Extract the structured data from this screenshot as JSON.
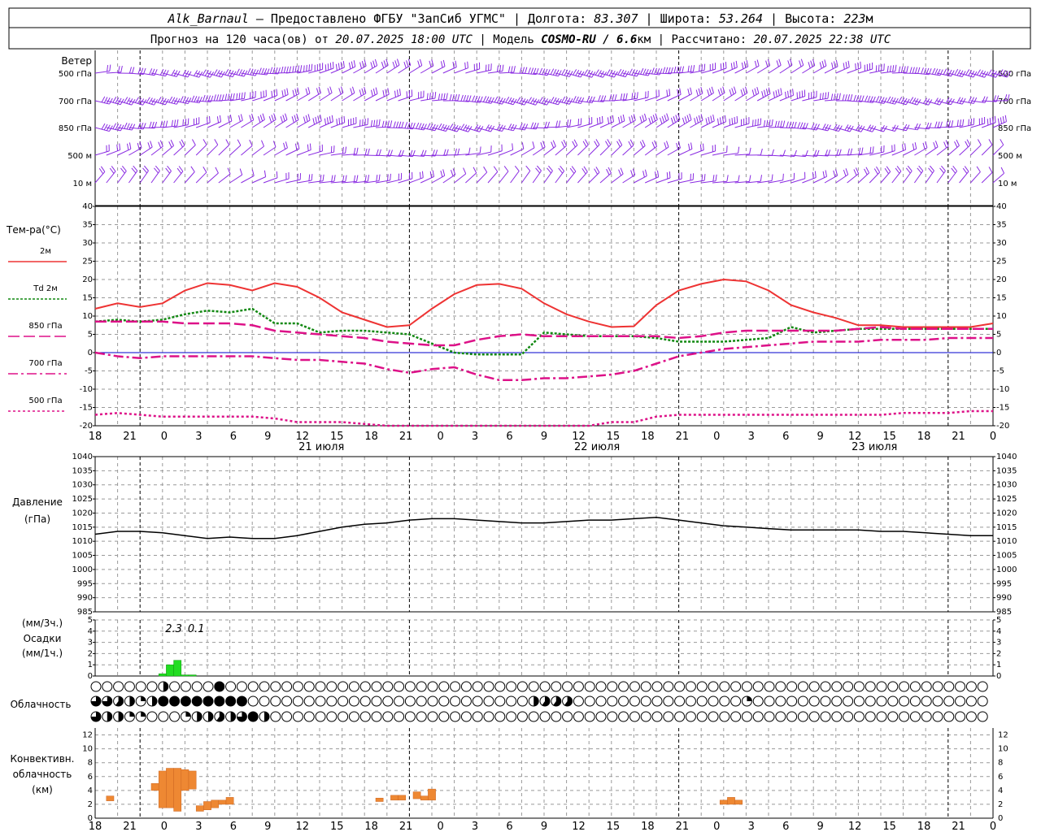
{
  "header": {
    "line1": {
      "station": "Alk_Barnaul",
      "provider": " – Предоставлено ФГБУ \"ЗапСиб УГМС\" | Долгота: ",
      "lon": "83.307",
      "lat_label": " | Широта: ",
      "lat": "53.264",
      "alt_label": " | Высота: ",
      "alt": "223",
      "alt_unit": "м"
    },
    "line2": {
      "prefix": "Прогноз на 120 часа(ов) от ",
      "init": "20.07.2025 18:00 UTC",
      "model_label": "  | Модель ",
      "model": "COSMO-RU / 6.6",
      "model_unit": "км",
      "calc_label": " | Рассчитано: ",
      "calc": "20.07.2025 22:38 UTC"
    }
  },
  "wind_panel": {
    "title": "Ветер",
    "levels": [
      "500 гПа",
      "700 гПа",
      "850 гПа",
      "500 м",
      "10  м"
    ],
    "colors": {
      "barb": "#8a2be2"
    }
  },
  "temp_panel": {
    "title": "Тем-ра(°C)",
    "legend": [
      {
        "label": "2м",
        "color": "#ee3333",
        "dash": ""
      },
      {
        "label": "Td  2м",
        "color": "#118811",
        "dash": "3,2"
      },
      {
        "label": "850 гПа",
        "color": "#dd1188",
        "dash": "14,5"
      },
      {
        "label": "700 гПа",
        "color": "#dd1188",
        "dash": "12,4,3,4"
      },
      {
        "label": "500 гПа",
        "color": "#dd1188",
        "dash": "3,3"
      }
    ],
    "ylim": [
      -20,
      40
    ],
    "yticks": [
      "40",
      "35",
      "30",
      "25",
      "20",
      "15",
      "10",
      "5",
      "0",
      "-5",
      "-10",
      "-15",
      "-20"
    ]
  },
  "x_axis": {
    "hour_labels": [
      "18",
      "21",
      "0",
      "3",
      "6",
      "9",
      "12",
      "15",
      "18",
      "21",
      "0",
      "3",
      "6",
      "9",
      "12",
      "15",
      "18",
      "21",
      "0",
      "3",
      "6",
      "9",
      "12",
      "15",
      "18",
      "21",
      "0"
    ],
    "day_labels": [
      "21 июля",
      "22 июля",
      "23 июля"
    ]
  },
  "pressure_panel": {
    "title": "Давление",
    "unit": "(гПа)",
    "ylim": [
      985,
      1040
    ],
    "yticks": [
      "1040",
      "1035",
      "1030",
      "1025",
      "1020",
      "1015",
      "1010",
      "1005",
      "1000",
      "995",
      "990",
      "985"
    ]
  },
  "precip_panel": {
    "unit3": "(мм/3ч.)",
    "title": "Осадки",
    "unit1": "(мм/1ч.)",
    "yticks": [
      "5",
      "4",
      "3",
      "2",
      "1",
      "0"
    ],
    "totals": [
      {
        "text": "2.3",
        "hour": 10.5
      },
      {
        "text": "0.1",
        "hour": 13.5
      }
    ]
  },
  "cloud_panel": {
    "title": "Облачность"
  },
  "conv_panel": {
    "title_lines": [
      "Конвективн.",
      "облачность",
      "(км)"
    ],
    "yticks": [
      "12",
      "10",
      "8",
      "6",
      "4",
      "2",
      "0"
    ]
  },
  "chart_data": [
    {
      "type": "line",
      "name": "temperature",
      "x_hours_from_start": [
        0,
        3,
        6,
        9,
        12,
        15,
        18,
        21,
        24,
        27,
        30,
        33,
        36,
        39,
        42,
        45,
        48,
        51,
        54,
        57,
        60,
        63,
        66,
        69,
        72,
        75,
        78,
        81,
        84,
        87,
        90,
        93,
        96,
        99,
        102,
        105,
        108,
        111,
        114,
        117,
        120
      ],
      "series": [
        {
          "name": "2м",
          "values": [
            12,
            13.5,
            12.5,
            13.5,
            17,
            19,
            18.5,
            17,
            19,
            18,
            15,
            11,
            9,
            7,
            7.5,
            12,
            16,
            18.5,
            18.8,
            17.5,
            13.5,
            10.5,
            8.5,
            7,
            7.2,
            13,
            17,
            18.8,
            20,
            19.5,
            17,
            13,
            11,
            9.5,
            7.5,
            7.5,
            7,
            7,
            7,
            7,
            8
          ]
        },
        {
          "name": "Td  2м",
          "values": [
            8.5,
            9,
            8.5,
            9,
            10.5,
            11.5,
            11,
            12,
            8,
            8,
            5.5,
            6,
            6,
            5.5,
            5,
            2.5,
            0,
            -0.5,
            -0.5,
            -0.5,
            5.5,
            5,
            4.5,
            4.5,
            4.5,
            4,
            3,
            3,
            3,
            3.5,
            4,
            7,
            5.5,
            6,
            6.5,
            6.5,
            6.5,
            6.5,
            6.5,
            6.5,
            6.5
          ]
        },
        {
          "name": "850 гПа",
          "values": [
            8.5,
            8.5,
            8.5,
            8.5,
            8,
            8,
            8,
            7.5,
            6,
            5.5,
            5,
            4.5,
            4,
            3,
            2.5,
            2,
            2,
            3.5,
            4.5,
            5,
            4.5,
            4.5,
            4.5,
            4.5,
            4.5,
            4.5,
            4,
            4.5,
            5.5,
            6,
            6,
            6,
            6,
            6,
            6.5,
            7,
            6.5,
            6.5,
            6.5,
            6.5,
            6.5
          ]
        },
        {
          "name": "700 гПа",
          "values": [
            0,
            -1,
            -1.5,
            -1,
            -1,
            -1,
            -1,
            -1,
            -1.5,
            -2,
            -2,
            -2.5,
            -3,
            -4.5,
            -5.5,
            -4.5,
            -4,
            -6,
            -7.5,
            -7.5,
            -7,
            -7,
            -6.5,
            -6,
            -5,
            -3,
            -1,
            0,
            1,
            1.5,
            2,
            2.5,
            3,
            3,
            3,
            3.5,
            3.5,
            3.5,
            4,
            4,
            4
          ]
        },
        {
          "name": "500 гПа",
          "values": [
            -17,
            -16.5,
            -17,
            -17.5,
            -17.5,
            -17.5,
            -17.5,
            -17.5,
            -18,
            -19,
            -19,
            -19,
            -19.5,
            -20,
            -20,
            -20,
            -20,
            -20,
            -20,
            -20,
            -20,
            -20,
            -20,
            -19,
            -19,
            -17.5,
            -17,
            -17,
            -17,
            -17,
            -17,
            -17,
            -17,
            -17,
            -17,
            -17,
            -16.5,
            -16.5,
            -16.5,
            -16,
            -16
          ]
        }
      ]
    },
    {
      "type": "line",
      "name": "pressure",
      "x_hours_from_start": [
        0,
        3,
        6,
        9,
        12,
        15,
        18,
        21,
        24,
        27,
        30,
        33,
        36,
        39,
        42,
        45,
        48,
        51,
        54,
        57,
        60,
        63,
        66,
        69,
        72,
        75,
        78,
        81,
        84,
        87,
        90,
        93,
        96,
        99,
        102,
        105,
        108,
        111,
        114,
        117,
        120
      ],
      "series": [
        {
          "name": "pressure",
          "values": [
            1012.5,
            1013.5,
            1013.5,
            1013,
            1012,
            1011,
            1011.5,
            1011,
            1011,
            1012,
            1013.5,
            1015,
            1016,
            1016.5,
            1017.5,
            1018,
            1018,
            1017.5,
            1017,
            1016.5,
            1016.5,
            1017,
            1017.5,
            1017.5,
            1018,
            1018.5,
            1017.5,
            1016.5,
            1015.5,
            1015,
            1014.5,
            1014,
            1014,
            1014,
            1014,
            1013.5,
            1013.5,
            1013,
            1012.5,
            1012,
            1012
          ]
        }
      ]
    },
    {
      "type": "bar",
      "name": "precipitation_mm_per_hour",
      "bars": [
        {
          "hour": 9,
          "value": 0.2
        },
        {
          "hour": 10,
          "value": 1.0
        },
        {
          "hour": 11,
          "value": 1.4
        },
        {
          "hour": 12,
          "value": 0.1
        },
        {
          "hour": 13,
          "value": 0.1
        }
      ],
      "ylim": [
        0,
        5
      ]
    },
    {
      "type": "bar",
      "name": "convective_cloud_km",
      "bars": [
        {
          "hour": 2,
          "base": 2.5,
          "top": 3.2
        },
        {
          "hour": 8,
          "base": 4.0,
          "top": 5.0
        },
        {
          "hour": 9,
          "base": 1.5,
          "top": 6.8
        },
        {
          "hour": 10,
          "base": 1.5,
          "top": 7.2
        },
        {
          "hour": 11,
          "base": 1.0,
          "top": 7.2
        },
        {
          "hour": 12,
          "base": 4.0,
          "top": 7.0
        },
        {
          "hour": 13,
          "base": 4.2,
          "top": 6.8
        },
        {
          "hour": 14,
          "base": 1.0,
          "top": 1.8
        },
        {
          "hour": 15,
          "base": 1.2,
          "top": 2.4
        },
        {
          "hour": 16,
          "base": 1.5,
          "top": 2.6
        },
        {
          "hour": 17,
          "base": 2.0,
          "top": 2.6
        },
        {
          "hour": 18,
          "base": 2.0,
          "top": 3.0
        },
        {
          "hour": 38,
          "base": 2.4,
          "top": 2.9
        },
        {
          "hour": 40,
          "base": 2.6,
          "top": 3.3
        },
        {
          "hour": 41,
          "base": 2.6,
          "top": 3.3
        },
        {
          "hour": 43,
          "base": 2.8,
          "top": 3.8
        },
        {
          "hour": 44,
          "base": 2.6,
          "top": 3.2
        },
        {
          "hour": 45,
          "base": 2.6,
          "top": 4.2
        },
        {
          "hour": 84,
          "base": 2.0,
          "top": 2.6
        },
        {
          "hour": 85,
          "base": 2.0,
          "top": 3.0
        },
        {
          "hour": 86,
          "base": 2.0,
          "top": 2.6
        }
      ],
      "ylim": [
        0,
        13
      ]
    }
  ],
  "colors": {
    "axis": "#000000",
    "grid": "#999999",
    "precip": "#22dd22",
    "conv": "#ee8833",
    "pressure": "#000000",
    "zero_line": "#0000cc"
  }
}
